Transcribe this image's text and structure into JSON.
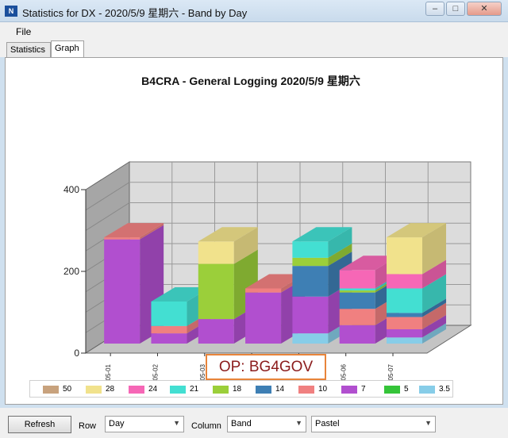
{
  "window": {
    "title": "Statistics for DX - 2020/5/9 星期六 - Band by Day",
    "icon": "app-icon",
    "controls": [
      "minimize-icon",
      "maximize-icon",
      "close-icon"
    ]
  },
  "menu": {
    "file": "File"
  },
  "tabs": [
    {
      "label": "Statistics"
    },
    {
      "label": "Graph"
    }
  ],
  "active_tab": "Graph",
  "chart_data": {
    "type": "bar",
    "stacked": true,
    "three_d": true,
    "title": "B4CRA - General Logging 2020/5/9 星期六",
    "categories": [
      "2020-05-01",
      "2020-05-02",
      "2020-05-03",
      "2020-05-04",
      "2020-05-05",
      "2020-05-06",
      "2020-05-07"
    ],
    "ylim": [
      0,
      400
    ],
    "yticks": [
      "400",
      "200",
      "0"
    ],
    "grid": true,
    "legend_position": "bottom",
    "colors": {
      "50": "#c8a27d",
      "28": "#f1e28c",
      "24": "#f667b6",
      "21": "#43dfd2",
      "18": "#9bcf3a",
      "14": "#3e7fb4",
      "10": "#f08080",
      "7": "#b14fcf",
      "5": "#35c439",
      "3.5": "#87cde8"
    },
    "series": [
      {
        "name": "3.5",
        "values": [
          0,
          0,
          0,
          0,
          25,
          0,
          15
        ]
      },
      {
        "name": "5",
        "values": [
          0,
          0,
          0,
          0,
          0,
          0,
          0
        ]
      },
      {
        "name": "7",
        "values": [
          255,
          25,
          60,
          125,
          90,
          45,
          20
        ]
      },
      {
        "name": "10",
        "values": [
          5,
          18,
          0,
          10,
          0,
          40,
          30
        ]
      },
      {
        "name": "14",
        "values": [
          0,
          0,
          0,
          0,
          75,
          40,
          10
        ]
      },
      {
        "name": "18",
        "values": [
          0,
          0,
          135,
          0,
          20,
          5,
          0
        ]
      },
      {
        "name": "21",
        "values": [
          0,
          60,
          0,
          0,
          40,
          5,
          60
        ]
      },
      {
        "name": "24",
        "values": [
          0,
          0,
          0,
          0,
          0,
          45,
          35
        ]
      },
      {
        "name": "28",
        "values": [
          0,
          0,
          55,
          0,
          0,
          0,
          90
        ]
      },
      {
        "name": "50",
        "values": [
          0,
          0,
          0,
          0,
          0,
          0,
          0
        ]
      }
    ]
  },
  "annotation": "OP: BG4GOV",
  "legend": [
    {
      "name": "50",
      "color": "#c8a27d"
    },
    {
      "name": "28",
      "color": "#f1e28c"
    },
    {
      "name": "24",
      "color": "#f667b6"
    },
    {
      "name": "21",
      "color": "#43dfd2"
    },
    {
      "name": "18",
      "color": "#9bcf3a"
    },
    {
      "name": "14",
      "color": "#3e7fb4"
    },
    {
      "name": "10",
      "color": "#f08080"
    },
    {
      "name": "7",
      "color": "#b14fcf"
    },
    {
      "name": "5",
      "color": "#35c439"
    },
    {
      "name": "3.5",
      "color": "#87cde8"
    }
  ],
  "bottom": {
    "refresh": "Refresh",
    "row_label": "Row",
    "row_value": "Day",
    "column_label": "Column",
    "column_value": "Band",
    "palette_value": "Pastel"
  }
}
